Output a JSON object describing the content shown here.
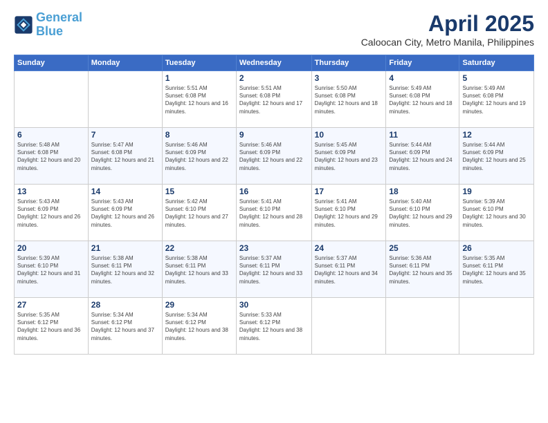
{
  "logo": {
    "line1": "General",
    "line2": "Blue"
  },
  "title": "April 2025",
  "subtitle": "Caloocan City, Metro Manila, Philippines",
  "weekdays": [
    "Sunday",
    "Monday",
    "Tuesday",
    "Wednesday",
    "Thursday",
    "Friday",
    "Saturday"
  ],
  "weeks": [
    [
      {
        "day": "",
        "info": ""
      },
      {
        "day": "",
        "info": ""
      },
      {
        "day": "1",
        "info": "Sunrise: 5:51 AM\nSunset: 6:08 PM\nDaylight: 12 hours and 16 minutes."
      },
      {
        "day": "2",
        "info": "Sunrise: 5:51 AM\nSunset: 6:08 PM\nDaylight: 12 hours and 17 minutes."
      },
      {
        "day": "3",
        "info": "Sunrise: 5:50 AM\nSunset: 6:08 PM\nDaylight: 12 hours and 18 minutes."
      },
      {
        "day": "4",
        "info": "Sunrise: 5:49 AM\nSunset: 6:08 PM\nDaylight: 12 hours and 18 minutes."
      },
      {
        "day": "5",
        "info": "Sunrise: 5:49 AM\nSunset: 6:08 PM\nDaylight: 12 hours and 19 minutes."
      }
    ],
    [
      {
        "day": "6",
        "info": "Sunrise: 5:48 AM\nSunset: 6:08 PM\nDaylight: 12 hours and 20 minutes."
      },
      {
        "day": "7",
        "info": "Sunrise: 5:47 AM\nSunset: 6:08 PM\nDaylight: 12 hours and 21 minutes."
      },
      {
        "day": "8",
        "info": "Sunrise: 5:46 AM\nSunset: 6:09 PM\nDaylight: 12 hours and 22 minutes."
      },
      {
        "day": "9",
        "info": "Sunrise: 5:46 AM\nSunset: 6:09 PM\nDaylight: 12 hours and 22 minutes."
      },
      {
        "day": "10",
        "info": "Sunrise: 5:45 AM\nSunset: 6:09 PM\nDaylight: 12 hours and 23 minutes."
      },
      {
        "day": "11",
        "info": "Sunrise: 5:44 AM\nSunset: 6:09 PM\nDaylight: 12 hours and 24 minutes."
      },
      {
        "day": "12",
        "info": "Sunrise: 5:44 AM\nSunset: 6:09 PM\nDaylight: 12 hours and 25 minutes."
      }
    ],
    [
      {
        "day": "13",
        "info": "Sunrise: 5:43 AM\nSunset: 6:09 PM\nDaylight: 12 hours and 26 minutes."
      },
      {
        "day": "14",
        "info": "Sunrise: 5:43 AM\nSunset: 6:09 PM\nDaylight: 12 hours and 26 minutes."
      },
      {
        "day": "15",
        "info": "Sunrise: 5:42 AM\nSunset: 6:10 PM\nDaylight: 12 hours and 27 minutes."
      },
      {
        "day": "16",
        "info": "Sunrise: 5:41 AM\nSunset: 6:10 PM\nDaylight: 12 hours and 28 minutes."
      },
      {
        "day": "17",
        "info": "Sunrise: 5:41 AM\nSunset: 6:10 PM\nDaylight: 12 hours and 29 minutes."
      },
      {
        "day": "18",
        "info": "Sunrise: 5:40 AM\nSunset: 6:10 PM\nDaylight: 12 hours and 29 minutes."
      },
      {
        "day": "19",
        "info": "Sunrise: 5:39 AM\nSunset: 6:10 PM\nDaylight: 12 hours and 30 minutes."
      }
    ],
    [
      {
        "day": "20",
        "info": "Sunrise: 5:39 AM\nSunset: 6:10 PM\nDaylight: 12 hours and 31 minutes."
      },
      {
        "day": "21",
        "info": "Sunrise: 5:38 AM\nSunset: 6:11 PM\nDaylight: 12 hours and 32 minutes."
      },
      {
        "day": "22",
        "info": "Sunrise: 5:38 AM\nSunset: 6:11 PM\nDaylight: 12 hours and 33 minutes."
      },
      {
        "day": "23",
        "info": "Sunrise: 5:37 AM\nSunset: 6:11 PM\nDaylight: 12 hours and 33 minutes."
      },
      {
        "day": "24",
        "info": "Sunrise: 5:37 AM\nSunset: 6:11 PM\nDaylight: 12 hours and 34 minutes."
      },
      {
        "day": "25",
        "info": "Sunrise: 5:36 AM\nSunset: 6:11 PM\nDaylight: 12 hours and 35 minutes."
      },
      {
        "day": "26",
        "info": "Sunrise: 5:35 AM\nSunset: 6:11 PM\nDaylight: 12 hours and 35 minutes."
      }
    ],
    [
      {
        "day": "27",
        "info": "Sunrise: 5:35 AM\nSunset: 6:12 PM\nDaylight: 12 hours and 36 minutes."
      },
      {
        "day": "28",
        "info": "Sunrise: 5:34 AM\nSunset: 6:12 PM\nDaylight: 12 hours and 37 minutes."
      },
      {
        "day": "29",
        "info": "Sunrise: 5:34 AM\nSunset: 6:12 PM\nDaylight: 12 hours and 38 minutes."
      },
      {
        "day": "30",
        "info": "Sunrise: 5:33 AM\nSunset: 6:12 PM\nDaylight: 12 hours and 38 minutes."
      },
      {
        "day": "",
        "info": ""
      },
      {
        "day": "",
        "info": ""
      },
      {
        "day": "",
        "info": ""
      }
    ]
  ]
}
